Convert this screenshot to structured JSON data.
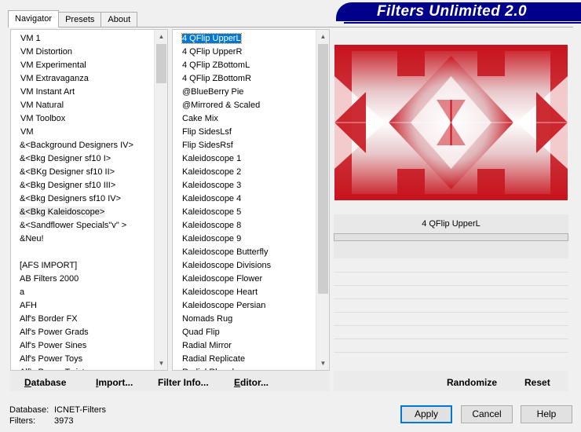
{
  "tabs": [
    "Navigator",
    "Presets",
    "About"
  ],
  "app_title": "Filters Unlimited 2.0",
  "categories": [
    "VM 1",
    "VM Distortion",
    "VM Experimental",
    "VM Extravaganza",
    "VM Instant Art",
    "VM Natural",
    "VM Toolbox",
    "VM",
    "&<Background Designers IV>",
    "&<Bkg Designer sf10 I>",
    "&<BKg Designer sf10 II>",
    "&<Bkg Designer sf10 III>",
    "&<Bkg Designers sf10 IV>",
    "&<Bkg Kaleidoscope>",
    "&<Sandflower Specials\"v\" >",
    "&Neu!",
    "",
    "[AFS IMPORT]",
    "AB Filters 2000",
    "a",
    "AFH",
    "Alf's Border FX",
    "Alf's Power Grads",
    "Alf's Power Sines",
    "Alf's Power Toys",
    "Alf's Power Twist"
  ],
  "filters": [
    "4 QFlip UpperL",
    "4 QFlip UpperR",
    "4 QFlip ZBottomL",
    "4 QFlip ZBottomR",
    "@BlueBerry Pie",
    "@Mirrored & Scaled",
    "Cake Mix",
    "Flip SidesLsf",
    "Flip SidesRsf",
    "Kaleidoscope 1",
    "Kaleidoscope 2",
    "Kaleidoscope 3",
    "Kaleidoscope 4",
    "Kaleidoscope 5",
    "Kaleidoscope 8",
    "Kaleidoscope 9",
    "Kaleidoscope Butterfly",
    "Kaleidoscope Divisions",
    "Kaleidoscope Flower",
    "Kaleidoscope Heart",
    "Kaleidoscope Persian",
    "Nomads Rug",
    "Quad Flip",
    "Radial Mirror",
    "Radial Replicate",
    "Radial Rhombus"
  ],
  "selected_filter": "4 QFlip UpperL",
  "toolbar": {
    "database": "Database",
    "import": "Import...",
    "filter_info": "Filter Info...",
    "editor": "Editor...",
    "randomize": "Randomize",
    "reset": "Reset"
  },
  "info": {
    "database_label": "Database:",
    "database_value": "ICNET-Filters",
    "filters_label": "Filters:",
    "filters_value": "3973"
  },
  "buttons": {
    "apply": "Apply",
    "cancel": "Cancel",
    "help": "Help"
  },
  "colors": {
    "banner": "#00008a",
    "accent_red": "#c8141e",
    "selection": "#0078d7"
  }
}
